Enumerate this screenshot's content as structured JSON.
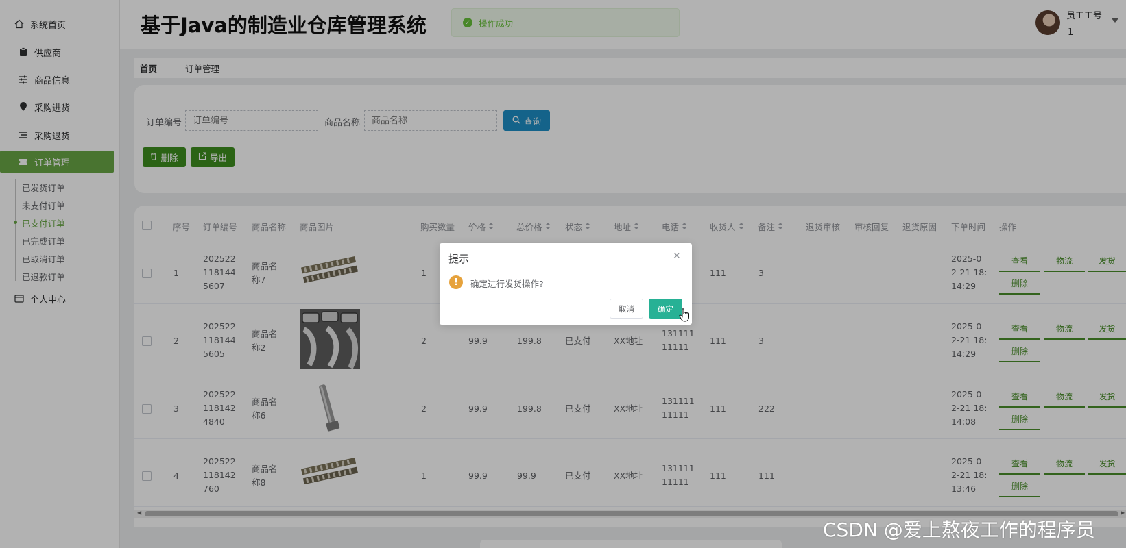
{
  "sidebar": {
    "home": "系统首页",
    "items": [
      {
        "label": "供应商",
        "icon": "clipboard-icon"
      },
      {
        "label": "商品信息",
        "icon": "sliders-icon"
      },
      {
        "label": "采购进货",
        "icon": "pin-icon"
      },
      {
        "label": "采购退货",
        "icon": "list-icon"
      },
      {
        "label": "订单管理",
        "icon": "ticket-icon"
      }
    ],
    "sub_items": [
      "已发货订单",
      "未支付订单",
      "已支付订单",
      "已完成订单",
      "已取消订单",
      "已退款订单"
    ],
    "profile": "个人中心",
    "accent": "#69a645"
  },
  "header": {
    "title": "基于Java的制造业仓库管理系统",
    "toast": "操作成功",
    "user_label": "员工工号",
    "user_id": "1"
  },
  "breadcrumb": {
    "home": "首页",
    "separator": "——",
    "current": "订单管理"
  },
  "search": {
    "order_label": "订单编号",
    "order_placeholder": "订单编号",
    "product_label": "商品名称",
    "product_placeholder": "商品名称",
    "query_button": "查询",
    "delete_button": "删除",
    "export_button": "导出"
  },
  "table": {
    "headers": [
      "序号",
      "订单编号",
      "商品名称",
      "商品图片",
      "购买数量",
      "价格",
      "总价格",
      "状态",
      "地址",
      "电话",
      "收货人",
      "备注",
      "退货审核",
      "审核回复",
      "退货原因",
      "下单时间",
      "操作"
    ],
    "rows": [
      {
        "index": "1",
        "order_no": [
          "202522",
          "118144",
          "5607"
        ],
        "product": [
          "商品名",
          "称7"
        ],
        "qty": "1",
        "price": "",
        "total": "",
        "status": "",
        "address": "",
        "phone": [
          "",
          ""
        ],
        "receiver": "111",
        "note": "3",
        "time": [
          "2025-0",
          "2-21 18:",
          "14:29"
        ]
      },
      {
        "index": "2",
        "order_no": [
          "202522",
          "118144",
          "5605"
        ],
        "product": [
          "商品名",
          "称2"
        ],
        "qty": "2",
        "price": "99.9",
        "total": "199.8",
        "status": "已支付",
        "address": "XX地址",
        "phone": [
          "131111",
          "11111"
        ],
        "receiver": "111",
        "note": "3",
        "time": [
          "2025-0",
          "2-21 18:",
          "14:29"
        ]
      },
      {
        "index": "3",
        "order_no": [
          "202522",
          "118142",
          "4840"
        ],
        "product": [
          "商品名",
          "称6"
        ],
        "qty": "2",
        "price": "99.9",
        "total": "199.8",
        "status": "已支付",
        "address": "XX地址",
        "phone": [
          "131111",
          "11111"
        ],
        "receiver": "111",
        "note": "222",
        "time": [
          "2025-0",
          "2-21 18:",
          "14:08"
        ]
      },
      {
        "index": "4",
        "order_no": [
          "202522",
          "118142",
          "760"
        ],
        "product": [
          "商品名",
          "称8"
        ],
        "qty": "1",
        "price": "99.9",
        "total": "99.9",
        "status": "已支付",
        "address": "XX地址",
        "phone": [
          "131111",
          "11111"
        ],
        "receiver": "111",
        "note": "111",
        "time": [
          "2025-0",
          "2-21 18:",
          "13:46"
        ]
      }
    ],
    "actions": {
      "view": "查看",
      "logistics": "物流",
      "ship": "发货",
      "delete": "删除"
    }
  },
  "dialog": {
    "title": "提示",
    "message": "确定进行发货操作?",
    "cancel": "取消",
    "confirm": "确定",
    "confirm_color": "#27b195"
  },
  "watermark": "CSDN @爱上熬夜工作的程序员"
}
